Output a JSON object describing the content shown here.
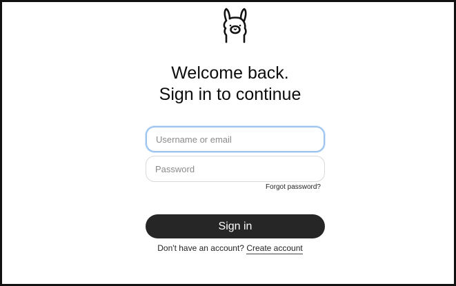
{
  "logo": {
    "icon": "llama-icon"
  },
  "heading": {
    "line1": "Welcome back.",
    "line2": "Sign in to continue"
  },
  "form": {
    "username_placeholder": "Username or email",
    "password_placeholder": "Password",
    "forgot_label": "Forgot password?",
    "submit_label": "Sign in"
  },
  "signup": {
    "prompt": "Don't have an account?",
    "link_label": "Create account"
  },
  "colors": {
    "button_bg": "#262626",
    "focus_ring": "#9cc4ef",
    "frame_border": "#111111"
  }
}
